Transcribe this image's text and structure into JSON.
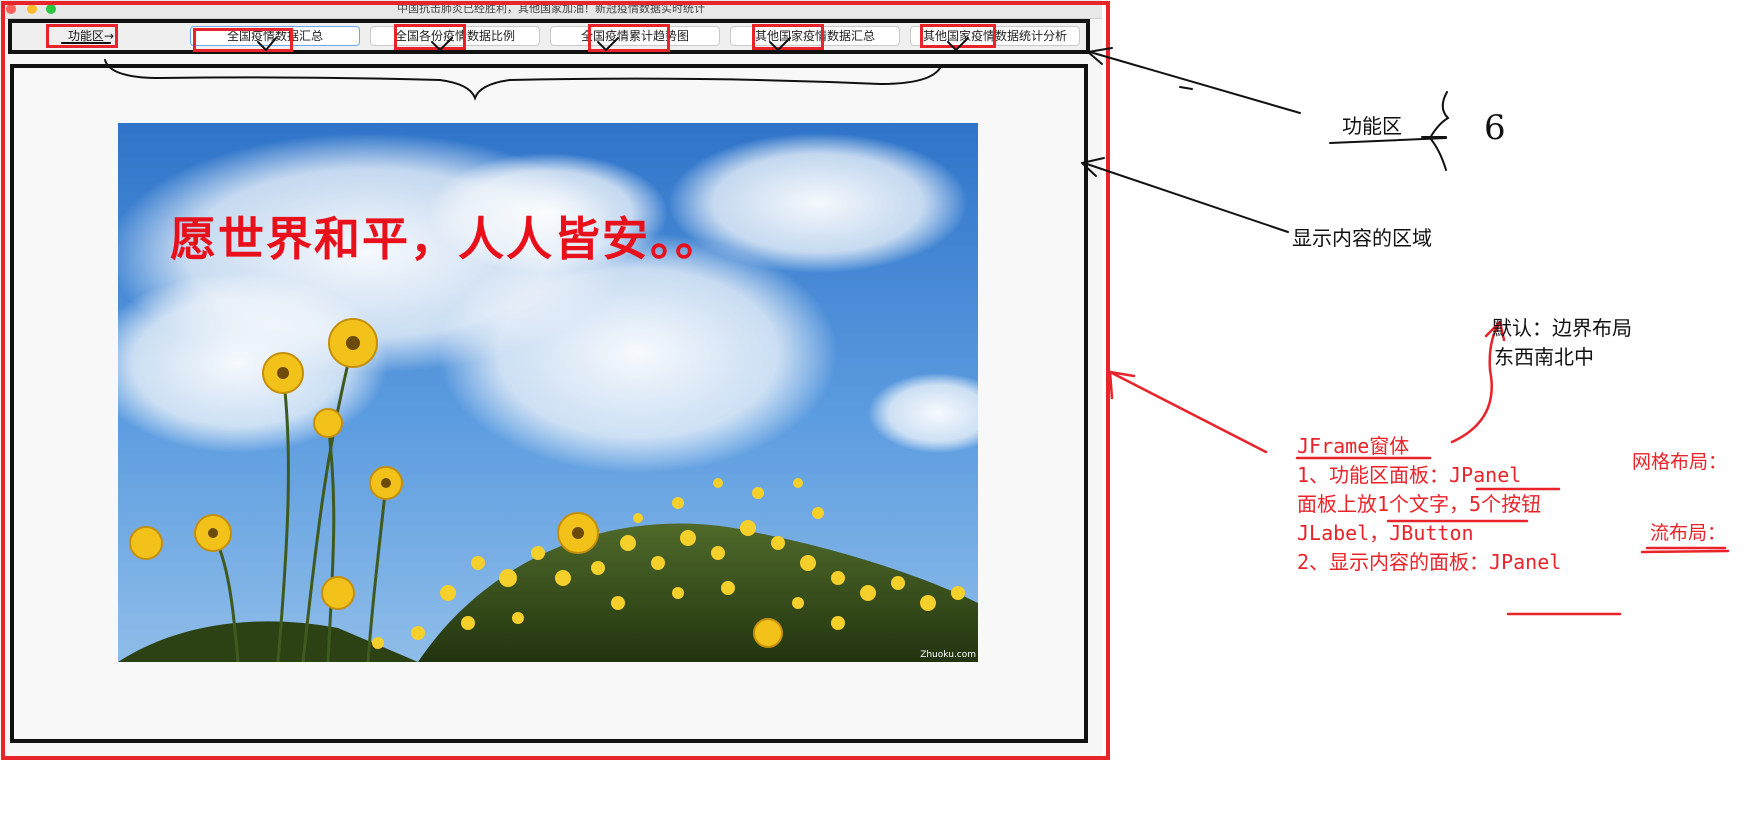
{
  "window": {
    "title": "中国抗击肺炎已经胜利，其他国家加油！新冠疫情数据实时统计"
  },
  "function_panel": {
    "label": "功能区→",
    "buttons": [
      {
        "label": "全国疫情数据汇总"
      },
      {
        "label": "全国各份疫情数据比例"
      },
      {
        "label": "全国疫情累计趋势图"
      },
      {
        "label": "其他国家疫情数据汇总"
      },
      {
        "label": "其他国家疫情数据统计分析"
      }
    ]
  },
  "content_panel": {
    "caption": "愿世界和平，人人皆安。。",
    "watermark": "Zhuoku.com"
  },
  "annotations": {
    "function_area": "功能区",
    "count": "6",
    "display_area": "显示内容的区域",
    "default_layout": "默认：边界布局",
    "directions": "东西南北中",
    "grid_layout": "网格布局：",
    "flow_layout": "流布局：",
    "jframe_notes": [
      "JFrame窗体",
      "1、功能区面板：JPanel",
      "面板上放1个文字，5个按钮",
      "JLabel，JButton",
      "",
      "2、显示内容的面板：JPanel"
    ]
  },
  "colors": {
    "annotation_red": "#e8232a",
    "caption_red": "#e8101a"
  }
}
